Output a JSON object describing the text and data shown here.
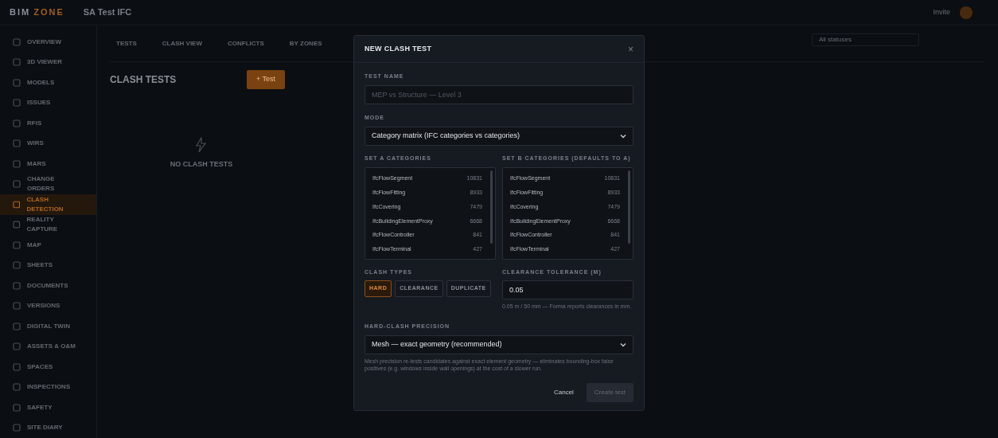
{
  "app": {
    "logo_a": "BIM",
    "logo_b": "ZONE",
    "project": "SA Test IFC",
    "top_actions": [
      "Invite"
    ]
  },
  "sidebar": {
    "items": [
      {
        "label": "OVERVIEW",
        "selected": false
      },
      {
        "label": "3D VIEWER",
        "selected": false
      },
      {
        "label": "MODELS",
        "selected": false
      },
      {
        "label": "ISSUES",
        "selected": false
      },
      {
        "label": "RFIS",
        "selected": false
      },
      {
        "label": "WIRS",
        "selected": false
      },
      {
        "label": "MARS",
        "selected": false
      },
      {
        "label": "CHANGE ORDERS",
        "selected": false
      },
      {
        "label": "CLASH DETECTION",
        "selected": true
      },
      {
        "label": "REALITY CAPTURE",
        "selected": false
      },
      {
        "label": "MAP",
        "selected": false
      },
      {
        "label": "SHEETS",
        "selected": false
      },
      {
        "label": "DOCUMENTS",
        "selected": false
      },
      {
        "label": "VERSIONS",
        "selected": false
      },
      {
        "label": "DIGITAL TWIN",
        "selected": false
      },
      {
        "label": "ASSETS & O&M",
        "selected": false
      },
      {
        "label": "SPACES",
        "selected": false
      },
      {
        "label": "INSPECTIONS",
        "selected": false
      },
      {
        "label": "SAFETY",
        "selected": false
      },
      {
        "label": "SITE DIARY",
        "selected": false
      }
    ]
  },
  "main": {
    "tabs": [
      "TESTS",
      "CLASH VIEW",
      "CONFLICTS",
      "BY ZONES"
    ],
    "title": "CLASH TESTS",
    "add_button": "+ Test",
    "empty_title": "NO CLASH TESTS",
    "filter": "All statuses"
  },
  "dialog": {
    "title": "NEW CLASH TEST",
    "close": "×",
    "test_name": {
      "label": "TEST NAME",
      "placeholder": "MEP vs Structure — Level 3"
    },
    "mode": {
      "label": "MODE",
      "value": "Category matrix (IFC categories vs categories)"
    },
    "set_a": {
      "label": "SET A CATEGORIES",
      "items": [
        {
          "name": "IfcFlowSegment",
          "count": "10831"
        },
        {
          "name": "IfcFlowFitting",
          "count": "8933"
        },
        {
          "name": "IfcCovering",
          "count": "7479"
        },
        {
          "name": "IfcBuildingElementProxy",
          "count": "6668"
        },
        {
          "name": "IfcFlowController",
          "count": "841"
        },
        {
          "name": "IfcFlowTerminal",
          "count": "427"
        }
      ]
    },
    "set_b": {
      "label": "SET B CATEGORIES (DEFAULTS TO A)",
      "items": [
        {
          "name": "IfcFlowSegment",
          "count": "10831"
        },
        {
          "name": "IfcFlowFitting",
          "count": "8933"
        },
        {
          "name": "IfcCovering",
          "count": "7479"
        },
        {
          "name": "IfcBuildingElementProxy",
          "count": "6668"
        },
        {
          "name": "IfcFlowController",
          "count": "841"
        },
        {
          "name": "IfcFlowTerminal",
          "count": "427"
        }
      ]
    },
    "clash_types": {
      "label": "CLASH TYPES",
      "options": [
        {
          "label": "HARD",
          "selected": true
        },
        {
          "label": "CLEARANCE",
          "selected": false
        },
        {
          "label": "DUPLICATE",
          "selected": false
        }
      ]
    },
    "clearance": {
      "label": "CLEARANCE TOLERANCE (M)",
      "value": "0.05",
      "hint": "0.05 m / 50 mm — Forma reports clearances in mm."
    },
    "precision": {
      "label": "HARD-CLASH PRECISION",
      "value": "Mesh — exact geometry (recommended)",
      "help": "Mesh precision re-tests candidates against exact element geometry — eliminates bounding-box false positives (e.g. windows inside wall openings) at the cost of a slower run."
    },
    "buttons": [
      {
        "label": "Cancel",
        "kind": "secondary",
        "disabled": false
      },
      {
        "label": "Create test",
        "kind": "primary",
        "disabled": true
      }
    ]
  }
}
